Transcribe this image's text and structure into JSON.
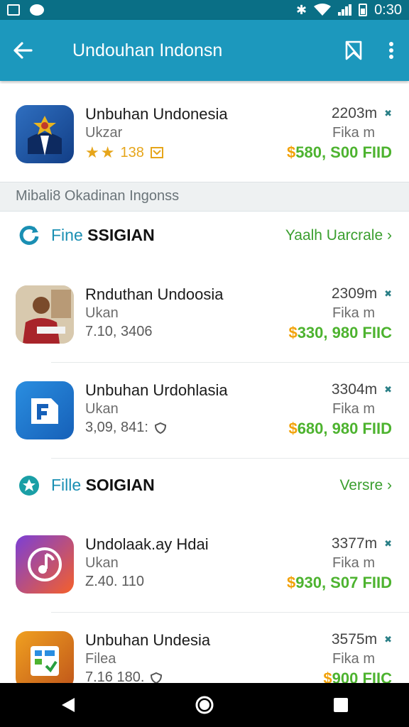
{
  "status_bar": {
    "time": "0:30"
  },
  "app_bar": {
    "title": "Undouhan Indonsn"
  },
  "featured": {
    "name": "Unbuhan Undonesia",
    "sub": "Ukzar",
    "rating_text": "138",
    "size": "2203m",
    "type": "Fika m",
    "price_currency": "$",
    "price_amount": "580, S00 FIID"
  },
  "section_label": "Mibali8 Okadinan Ingonss",
  "sections": [
    {
      "title_accent": "Fine",
      "title_bold": "SSIGIAN",
      "link": "Yaalh Uarcrale",
      "apps": [
        {
          "name": "Rnduthan Undoosia",
          "sub": "Ukan",
          "meta": "7.10, 3406",
          "size": "2309m",
          "type": "Fika m",
          "price_currency": "$",
          "price_amount": "330, 980 FIIC"
        },
        {
          "name": "Unbuhan Urdohlasia",
          "sub": "Ukan",
          "meta": "3,09, 841:",
          "size": "3304m",
          "type": "Fika m",
          "price_currency": "$",
          "price_amount": "680, 980 FIID"
        }
      ]
    },
    {
      "title_accent": "Fille",
      "title_bold": "SOIGIAN",
      "link": "Versre",
      "apps": [
        {
          "name": "Undolaak.ay Hdai",
          "sub": "Ukan",
          "meta": "Z.40. 110",
          "size": "3377m",
          "type": "Fika m",
          "price_currency": "$",
          "price_amount": "930, S07 FIID"
        },
        {
          "name": "Unbuhan Undesia",
          "sub": "Filea",
          "meta": "7.16 180.",
          "size": "3575m",
          "type": "Fika m",
          "price_currency": "$",
          "price_amount": "900 FIIC"
        }
      ]
    }
  ],
  "icons": {
    "back": "arrow-left-icon",
    "bookmark": "bookmark-icon",
    "more": "more-vert-icon"
  },
  "colors": {
    "app_bar": "#1c98bd",
    "status_bar": "#0a6f86",
    "price_green": "#4db32f",
    "currency_gold": "#f2a20a"
  }
}
